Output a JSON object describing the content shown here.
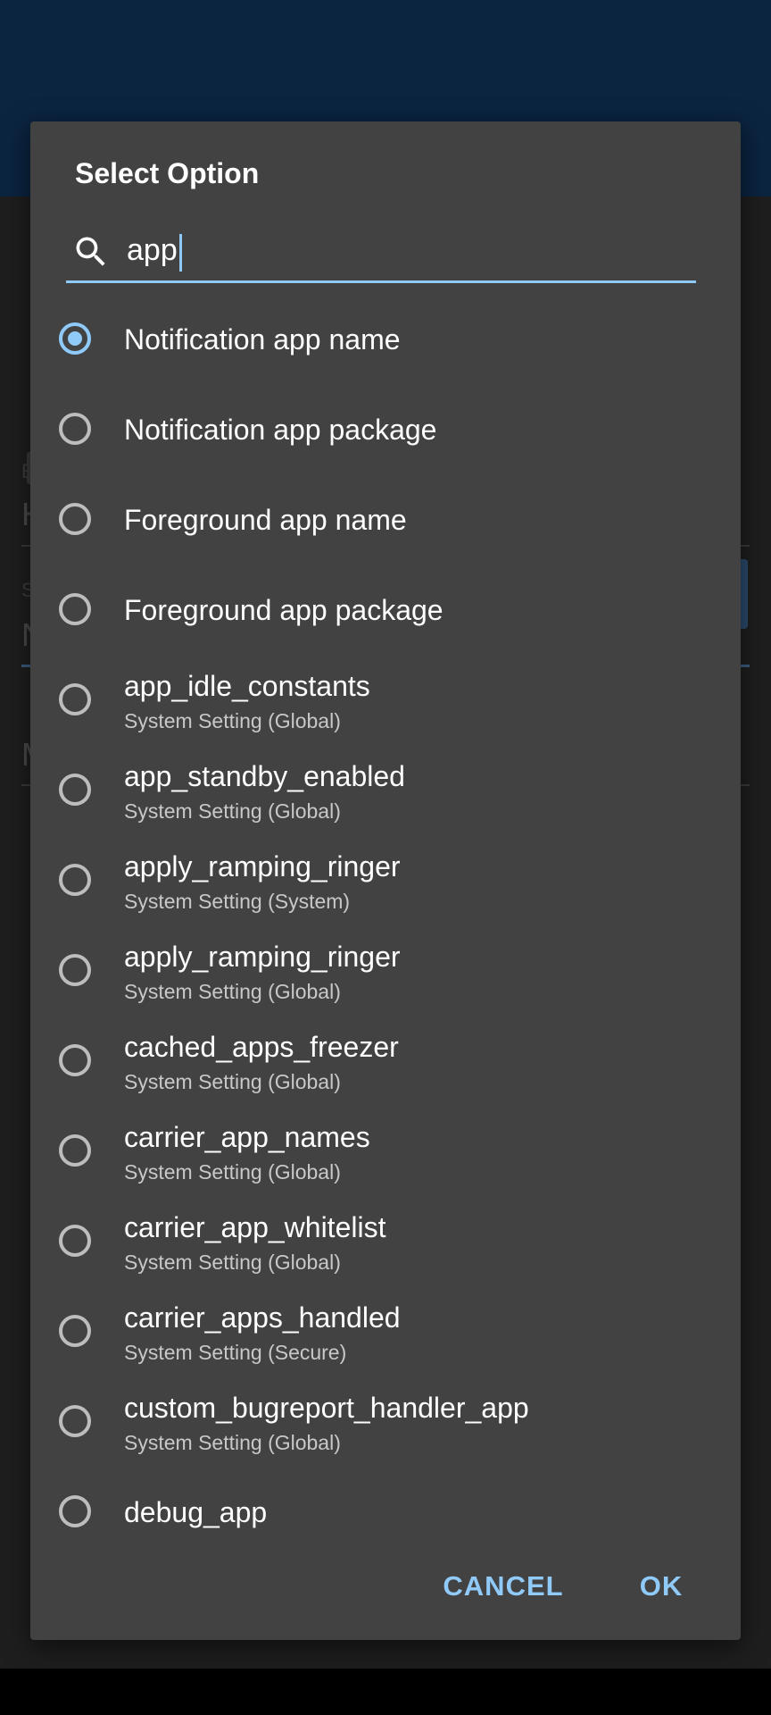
{
  "dialog": {
    "title": "Select Option",
    "search": {
      "value": "app",
      "placeholder": ""
    },
    "options": [
      {
        "label": "Notification app name",
        "sublabel": "",
        "checked": true
      },
      {
        "label": "Notification app package",
        "sublabel": "",
        "checked": false
      },
      {
        "label": "Foreground app name",
        "sublabel": "",
        "checked": false
      },
      {
        "label": "Foreground app package",
        "sublabel": "",
        "checked": false
      },
      {
        "label": "app_idle_constants",
        "sublabel": "System Setting (Global)",
        "checked": false
      },
      {
        "label": "app_standby_enabled",
        "sublabel": "System Setting (Global)",
        "checked": false
      },
      {
        "label": "apply_ramping_ringer",
        "sublabel": "System Setting (System)",
        "checked": false
      },
      {
        "label": "apply_ramping_ringer",
        "sublabel": "System Setting (Global)",
        "checked": false
      },
      {
        "label": "cached_apps_freezer",
        "sublabel": "System Setting (Global)",
        "checked": false
      },
      {
        "label": "carrier_app_names",
        "sublabel": "System Setting (Global)",
        "checked": false
      },
      {
        "label": "carrier_app_whitelist",
        "sublabel": "System Setting (Global)",
        "checked": false
      },
      {
        "label": "carrier_apps_handled",
        "sublabel": "System Setting (Secure)",
        "checked": false
      },
      {
        "label": "custom_bugreport_handler_app",
        "sublabel": "System Setting (Global)",
        "checked": false
      },
      {
        "label": "debug_app",
        "sublabel": "",
        "checked": false
      }
    ],
    "buttons": {
      "cancel": "CANCEL",
      "ok": "OK"
    }
  },
  "background": {
    "fragments": [
      "E",
      "H",
      "S",
      "N",
      "M"
    ]
  },
  "colors": {
    "accent": "#90caf9",
    "dialog_bg": "#424242",
    "header_bg": "#0b2440",
    "scrim_bg": "#1e1e1e",
    "text_primary": "#ffffff",
    "text_secondary": "#c8c8c8"
  },
  "icons": {
    "search": "search-icon",
    "radio_checked": "radio-checked-icon",
    "radio_unchecked": "radio-unchecked-icon"
  }
}
